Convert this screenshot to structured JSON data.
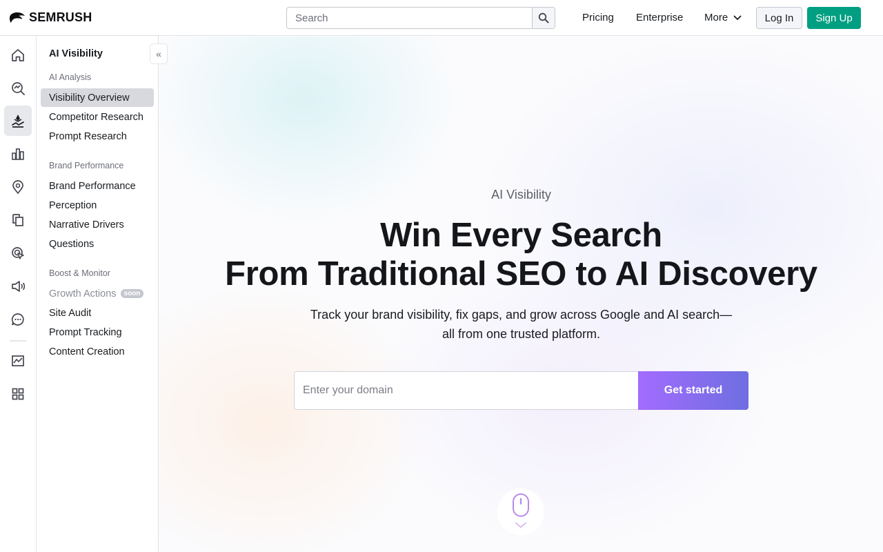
{
  "header": {
    "logo_text": "SEMRUSH",
    "search_placeholder": "Search",
    "nav": {
      "pricing": "Pricing",
      "enterprise": "Enterprise",
      "more": "More"
    },
    "login_label": "Log In",
    "signup_label": "Sign Up"
  },
  "sidebar": {
    "title": "AI Visibility",
    "sections": [
      {
        "label": "AI Analysis",
        "items": [
          "Visibility Overview",
          "Competitor Research",
          "Prompt Research"
        ]
      },
      {
        "label": "Brand Performance",
        "items": [
          "Brand Performance",
          "Perception",
          "Narrative Drivers",
          "Questions"
        ]
      },
      {
        "label": "Boost & Monitor",
        "items": [
          "Growth Actions",
          "Site Audit",
          "Prompt Tracking",
          "Content Creation"
        ]
      }
    ],
    "active_item": "Visibility Overview",
    "soon_badge": "soon"
  },
  "hero": {
    "kicker": "AI Visibility",
    "headline_line1": "Win Every Search",
    "headline_line2": "From Traditional SEO to AI Discovery",
    "subline_line1": "Track your brand visibility, fix gaps, and grow across Google and AI search—",
    "subline_line2": "all from one trusted platform.",
    "domain_placeholder": "Enter your domain",
    "cta_label": "Get started"
  },
  "colors": {
    "brand_green": "#009f81",
    "cta_gradient_start": "#a36cff",
    "cta_gradient_end": "#6e6ee0"
  },
  "icons": {
    "rail": [
      "home-icon",
      "search-analytics-icon",
      "ai-visibility-icon",
      "bar-chart-icon",
      "location-pin-icon",
      "copy-pages-icon",
      "target-cursor-icon",
      "megaphone-icon",
      "chat-bubble-icon",
      "trend-chart-icon",
      "apps-grid-icon"
    ]
  }
}
